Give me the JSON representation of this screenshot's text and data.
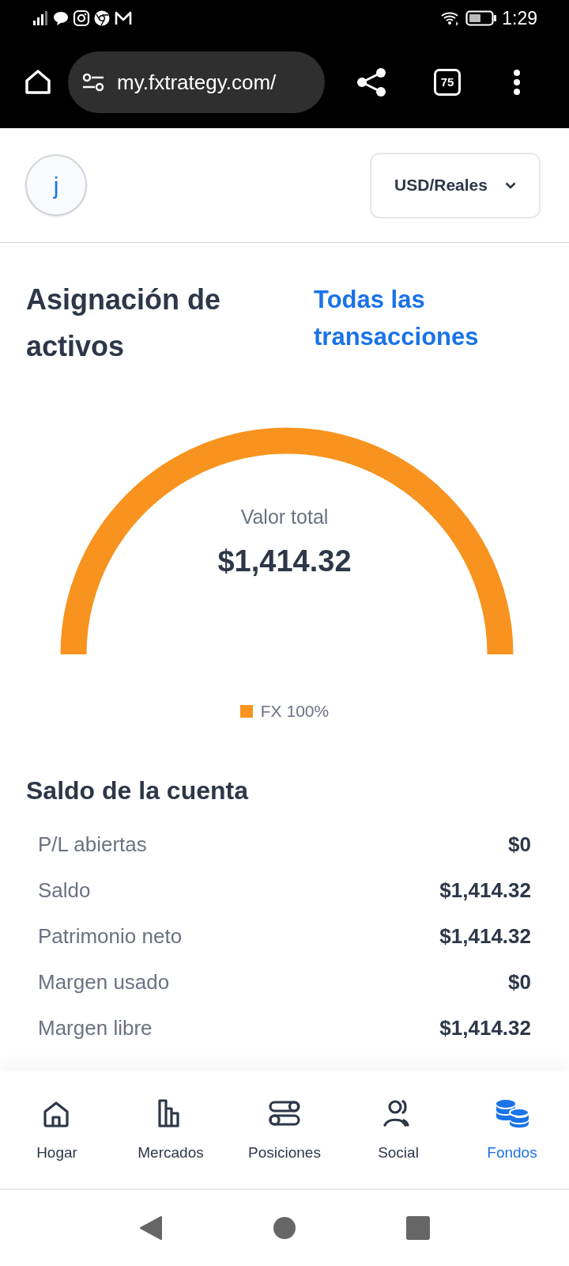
{
  "status_bar": {
    "time": "1:29"
  },
  "browser": {
    "url": "my.fxtrategy.com/",
    "tab_count": "75"
  },
  "header": {
    "avatar": "j",
    "currency_selector": "USD/Reales"
  },
  "allocation": {
    "title": "Asignación de activos",
    "link": "Todas las transacciones",
    "center_label": "Valor total",
    "center_value": "$1,414.32",
    "legend": [
      {
        "label": "FX 100%",
        "color": "#f7931e"
      }
    ]
  },
  "balance": {
    "title": "Saldo de la cuenta",
    "rows": [
      {
        "label": "P/L abiertas",
        "value": "$0"
      },
      {
        "label": "Saldo",
        "value": "$1,414.32"
      },
      {
        "label": "Patrimonio neto",
        "value": "$1,414.32"
      },
      {
        "label": "Margen usado",
        "value": "$0"
      },
      {
        "label": "Margen libre",
        "value": "$1,414.32"
      }
    ]
  },
  "bottom_nav": [
    {
      "kind": "home",
      "label": "Hogar",
      "selected": false
    },
    {
      "kind": "markets",
      "label": "Mercados",
      "selected": false
    },
    {
      "kind": "positions",
      "label": "Posiciones",
      "selected": false
    },
    {
      "kind": "social",
      "label": "Social",
      "selected": false
    },
    {
      "kind": "funds",
      "label": "Fondos",
      "selected": true
    }
  ]
}
